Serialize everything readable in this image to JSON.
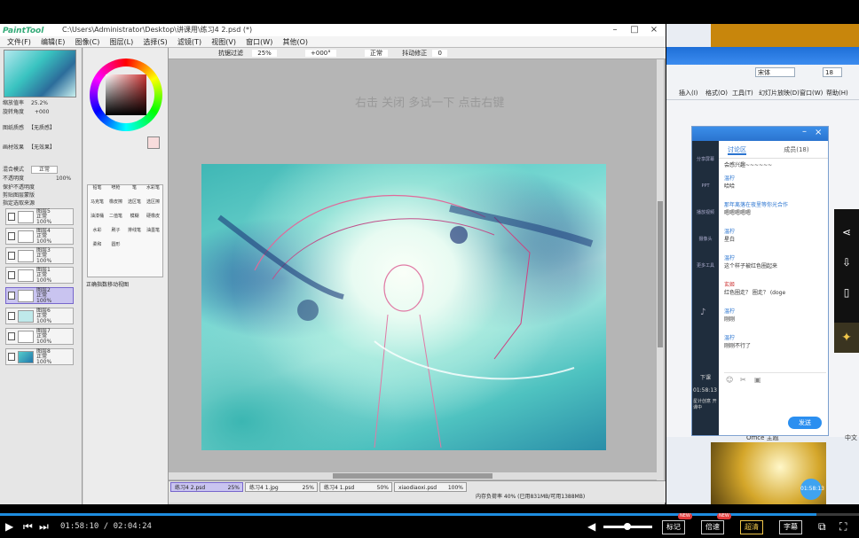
{
  "sai": {
    "logo": "PaintTool SAI",
    "file_path": "C:\\Users\\Administrator\\Desktop\\讲课用\\练习4 2.psd (*)",
    "menu": [
      "文件(F)",
      "编辑(E)",
      "图像(C)",
      "图层(L)",
      "选择(S)",
      "滤镜(T)",
      "视图(V)",
      "窗口(W)",
      "其他(O)"
    ],
    "toolbar": {
      "anti_alias": "抗锯过滤",
      "zoom": "25%",
      "rotation": "+000°",
      "mode": "正常",
      "stabilizer_label": "抖动修正",
      "stabilizer_value": "0"
    },
    "nav": {
      "zoom_label": "缩放值率",
      "zoom_value": "25.2%",
      "angle_label": "旋转角度",
      "angle_value": "+000"
    },
    "layer_panel": {
      "mask_label": "图纸质感",
      "mask_value": "【无质感】",
      "effect_label": "画材效果",
      "effect_value": "【无效果】",
      "blend_label": "混合模式",
      "blend_value": "正常",
      "opacity_label": "不透明度",
      "opacity_value": "100%",
      "check1": "保护不透明度",
      "check2": "剪贴图层蒙版",
      "check3": "指定选取来源"
    },
    "layers": [
      {
        "name": "图层5",
        "mode": "正常",
        "opacity": "100%"
      },
      {
        "name": "图层4",
        "mode": "正常",
        "opacity": "100%"
      },
      {
        "name": "图层3",
        "mode": "正常",
        "opacity": "100%"
      },
      {
        "name": "图层1",
        "mode": "正常",
        "opacity": "100%"
      },
      {
        "name": "图层2",
        "mode": "正常",
        "opacity": "100%"
      },
      {
        "name": "图层6",
        "mode": "正常",
        "opacity": "100%"
      },
      {
        "name": "图层7",
        "mode": "正常",
        "opacity": "100%"
      },
      {
        "name": "图层8",
        "mode": "正常",
        "opacity": "100%"
      }
    ],
    "tools": [
      "铅笔",
      "喷枪",
      "笔",
      "水彩笔",
      "马克笔",
      "橡皮擦",
      "选区笔",
      "选区擦",
      "油漆桶",
      "二值笔",
      "模糊",
      "硬橡皮",
      "水彩",
      "刷子",
      "排线笔",
      "油墨笔",
      "柔和",
      "圆形"
    ],
    "tool_footer": "正确指数移动视图",
    "overlay_text": "右击 关闭 多试一下 点击右键",
    "file_tabs": [
      {
        "name": "练习4 2.psd",
        "zoom": "25%"
      },
      {
        "name": "练习4 1.jpg",
        "zoom": "25%"
      },
      {
        "name": "练习4 1.psd",
        "zoom": "50%"
      },
      {
        "name": "xiaodiaoxi.psd",
        "zoom": "100%"
      }
    ],
    "status": "内存负荷率 40% (已用831MB/可用1388MB)"
  },
  "right": {
    "font_name": "宋体",
    "font_size": "18",
    "menu": [
      "插入(I)",
      "格式(O)",
      "工具(T)",
      "幻灯片放映(D)",
      "窗口(W)",
      "帮助(H)"
    ],
    "office_theme": "Office 主题",
    "lang": "中文"
  },
  "chat": {
    "tabs": [
      "讨论区",
      "成员(18)"
    ],
    "side_items": [
      "分享屏幕",
      "PPT",
      "播放视频",
      "摄像头",
      "更多工具"
    ],
    "side_time": "01:58:13",
    "side_footer": "下课",
    "side_status": "星计创意 开课中",
    "intro": "会感兴趣~~~~~~",
    "messages": [
      {
        "who": "温柠",
        "text": "哈哈"
      },
      {
        "who": "那年离落在夜里等你光合作",
        "text": "嗯嗯嗯嗯嗯"
      },
      {
        "who": "温柠",
        "text": "星白"
      },
      {
        "who": "温柠",
        "text": "这个样子被红色圈起来"
      },
      {
        "who": "玄姬",
        "text": "红色圈走？ 圈走？ (doge"
      },
      {
        "who": "温柠",
        "text": "刚刚"
      },
      {
        "who": "温柠",
        "text": "刚刚不行了"
      }
    ],
    "send_label": "发送"
  },
  "player": {
    "current": "01:58:10",
    "total": "02:04:24",
    "progress": 0.95,
    "volume": 0.42,
    "buttons": [
      "标记",
      "倍速",
      "超清",
      "字幕"
    ],
    "new_badge": "NEW"
  }
}
